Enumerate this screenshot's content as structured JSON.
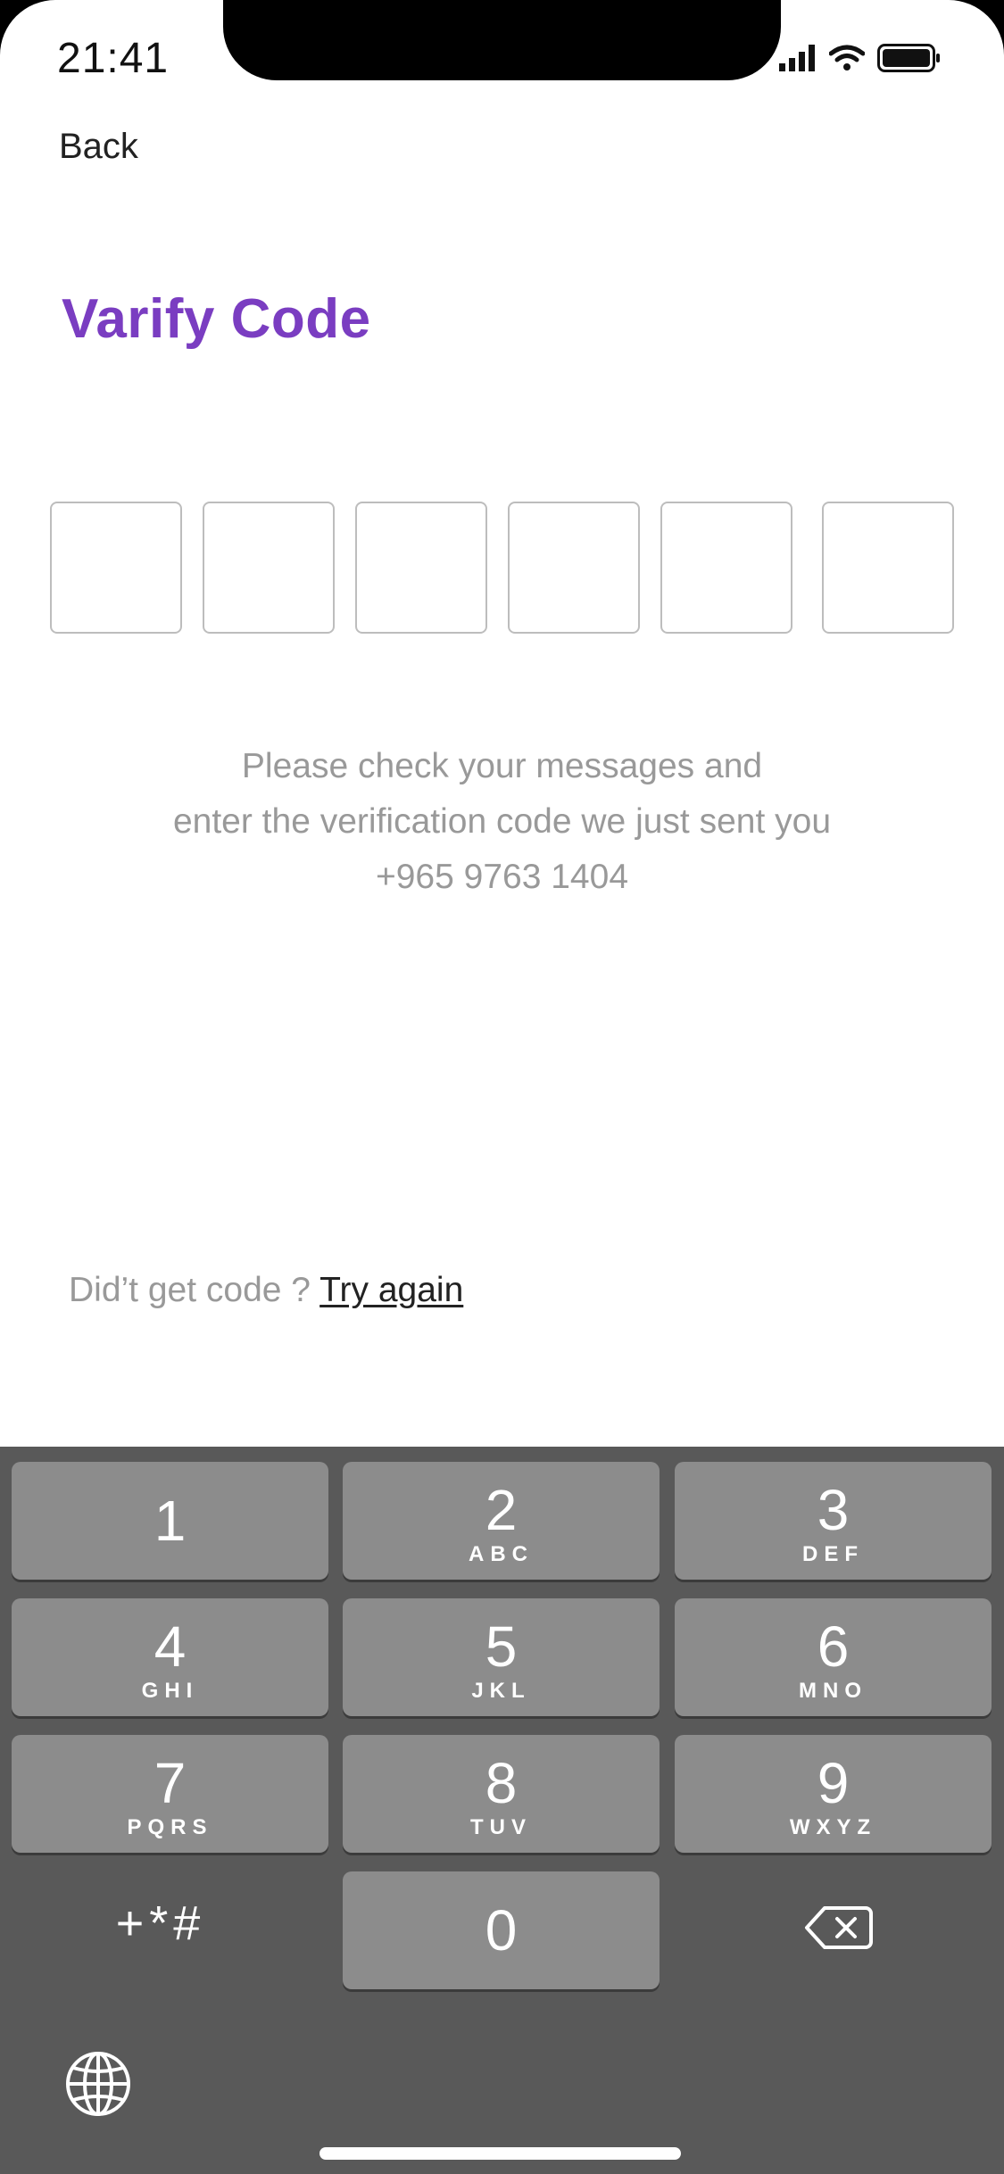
{
  "status_bar": {
    "time": "21:41"
  },
  "header": {
    "back_label": "Back",
    "title": "Varify Code"
  },
  "code_inputs": [
    "",
    "",
    "",
    "",
    "",
    ""
  ],
  "message": {
    "line1": "Please check your messages and",
    "line2": "enter the verification code we just sent you",
    "line3": "+965 9763 1404"
  },
  "retry": {
    "prompt": "Did’t get code ?",
    "link": "Try again"
  },
  "keypad": {
    "keys": [
      {
        "num": "1",
        "letters": ""
      },
      {
        "num": "2",
        "letters": "ABC"
      },
      {
        "num": "3",
        "letters": "DEF"
      },
      {
        "num": "4",
        "letters": "GHI"
      },
      {
        "num": "5",
        "letters": "JKL"
      },
      {
        "num": "6",
        "letters": "MNO"
      },
      {
        "num": "7",
        "letters": "PQRS"
      },
      {
        "num": "8",
        "letters": "TUV"
      },
      {
        "num": "9",
        "letters": "WXYZ"
      },
      {
        "num": "0",
        "letters": ""
      }
    ],
    "symbols_label": "+*#",
    "icons": {
      "delete": "backspace-icon",
      "globe": "globe-icon"
    }
  },
  "colors": {
    "accent": "#7a3dc1",
    "keypad_bg": "#595959",
    "key_bg": "#8c8c8c"
  }
}
